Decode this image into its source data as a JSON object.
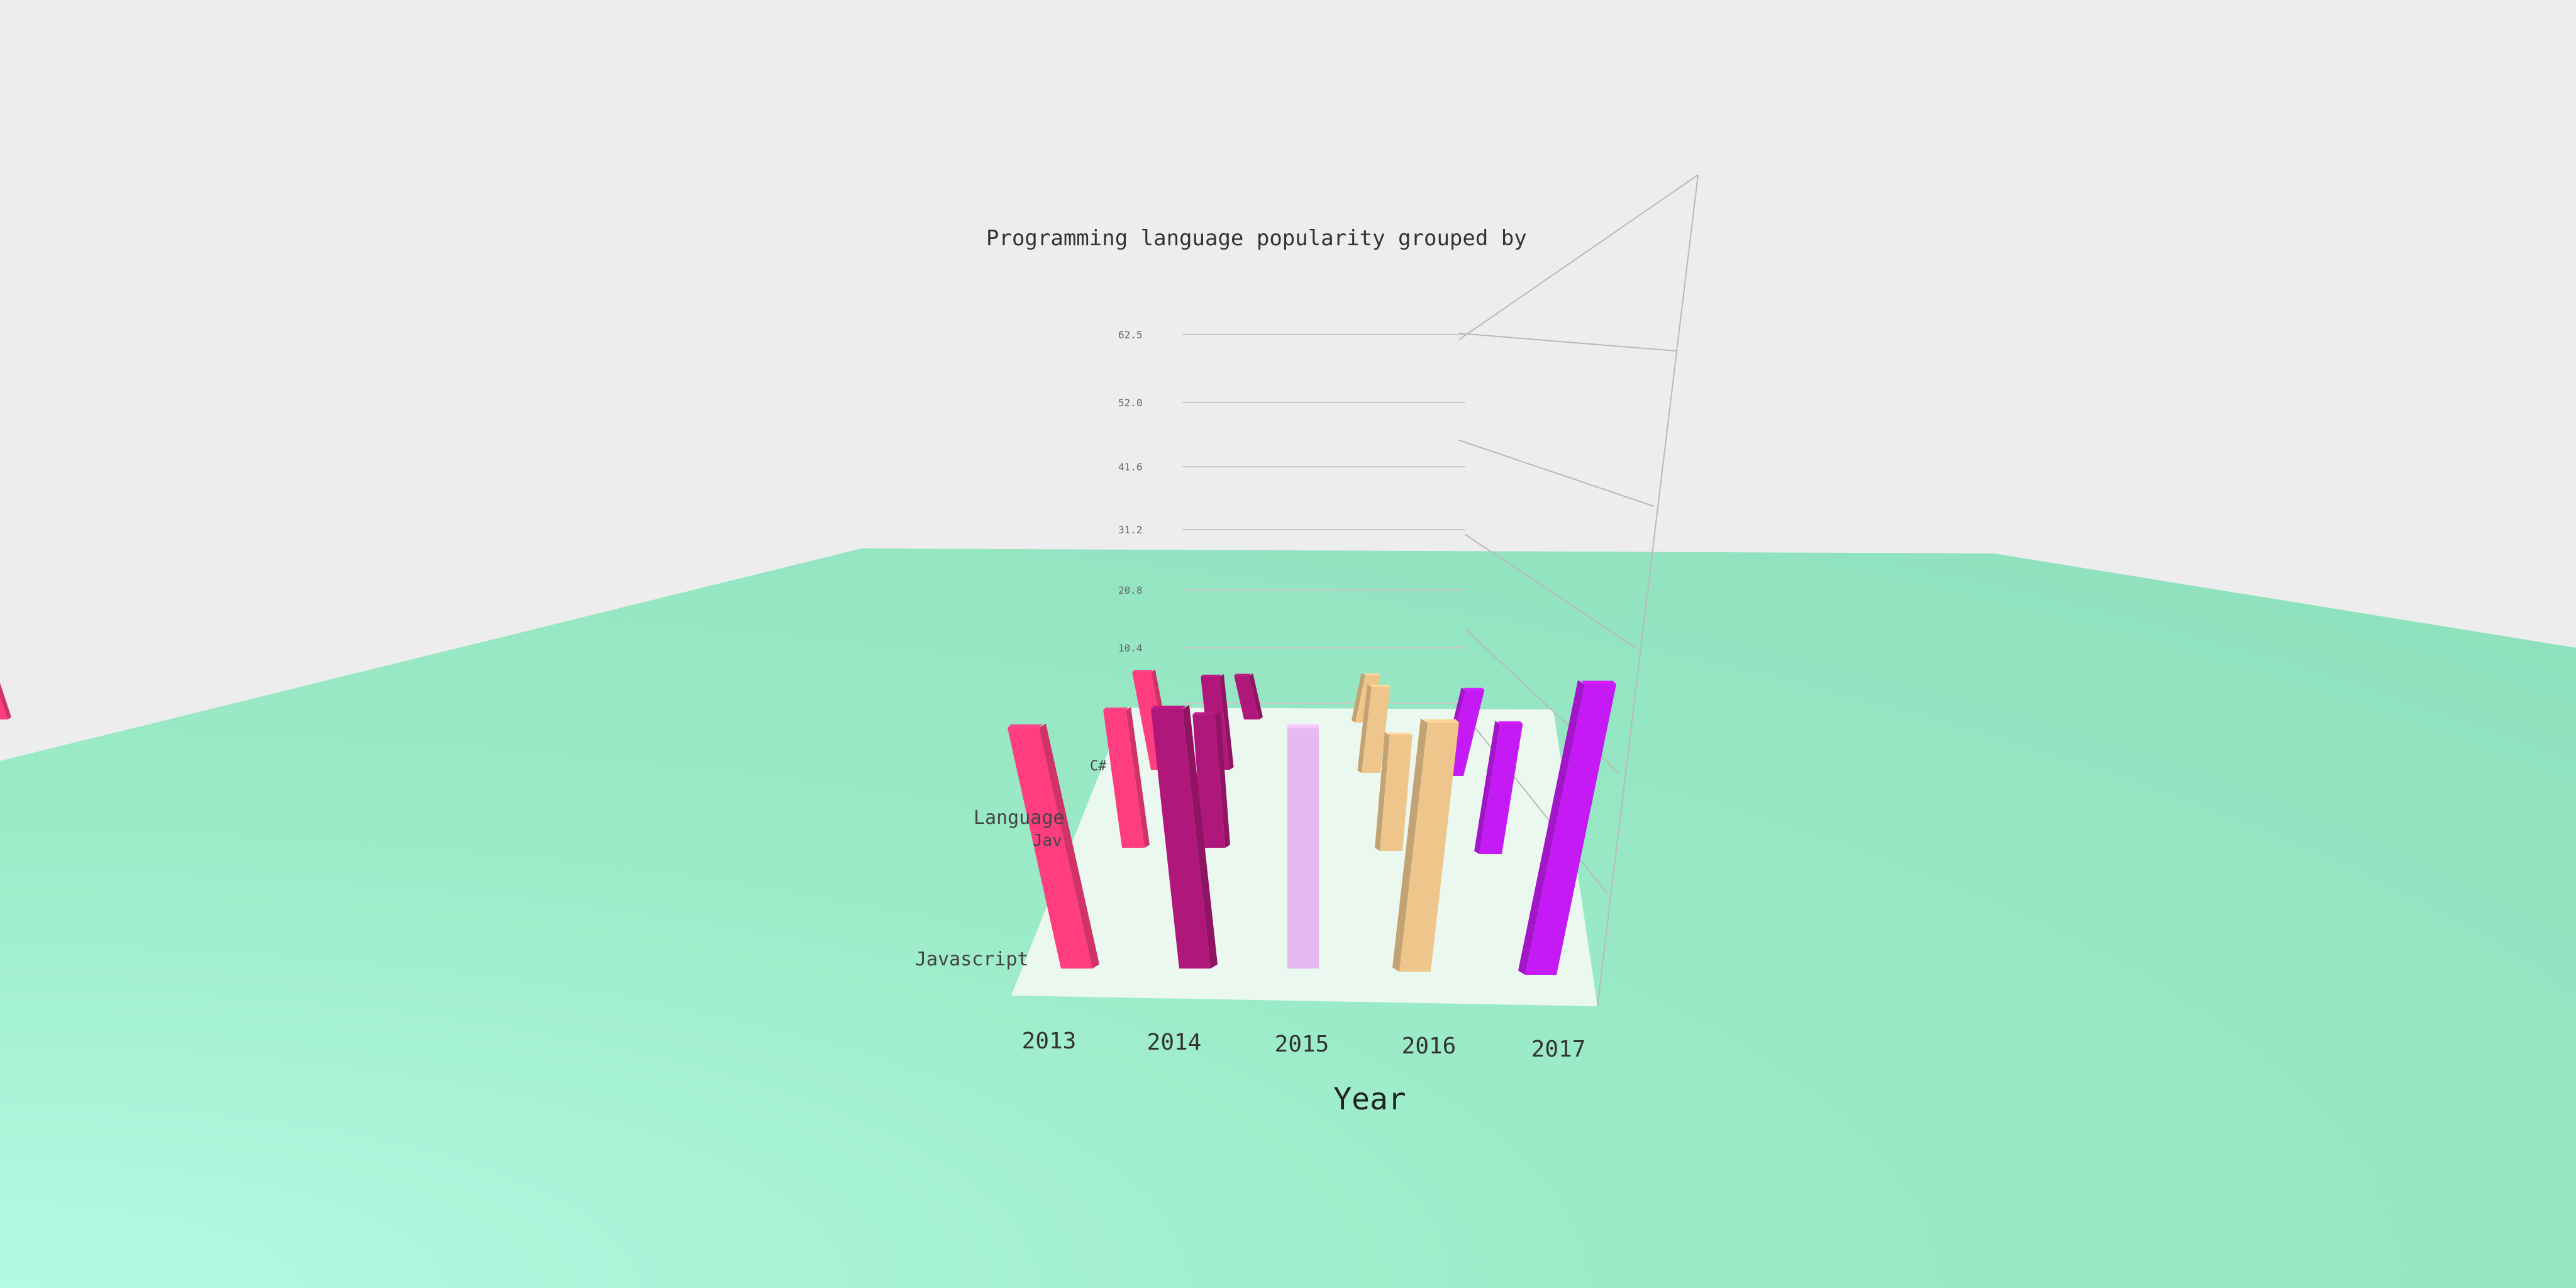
{
  "chart_data": {
    "type": "bar",
    "title": "Programming language popularity grouped by",
    "xlabel": "Year",
    "zlabel": "Language",
    "categories": [
      "2013",
      "2014",
      "2015",
      "2016",
      "2017"
    ],
    "languages_visible": [
      "Javascript",
      "Jav",
      "C#"
    ],
    "y_tick_labels": [
      "10.4",
      "20.8",
      "31.2",
      "41.6",
      "52.0",
      "62.5"
    ],
    "series": [
      {
        "color": "#ff3d7f",
        "values": [
          58.0,
          47.6,
          42.0,
          31.0
        ]
      },
      {
        "color": "#b0177a",
        "values": [
          62.5,
          46.0,
          40.0,
          24.0
        ]
      },
      {
        "color": "#e8b8f0",
        "values": [
          58.0
        ]
      },
      {
        "color": "#eec68c",
        "values": [
          60.0,
          40.0,
          37.0,
          26.0
        ]
      },
      {
        "color": "#c51af5",
        "values": [
          70.0,
          45.0,
          37.0
        ]
      }
    ],
    "colors": {
      "background": "#ededed",
      "floor": "#8de0bd",
      "floor_highlight": "#b4fbe4",
      "plate": "#eaf8ef"
    }
  }
}
